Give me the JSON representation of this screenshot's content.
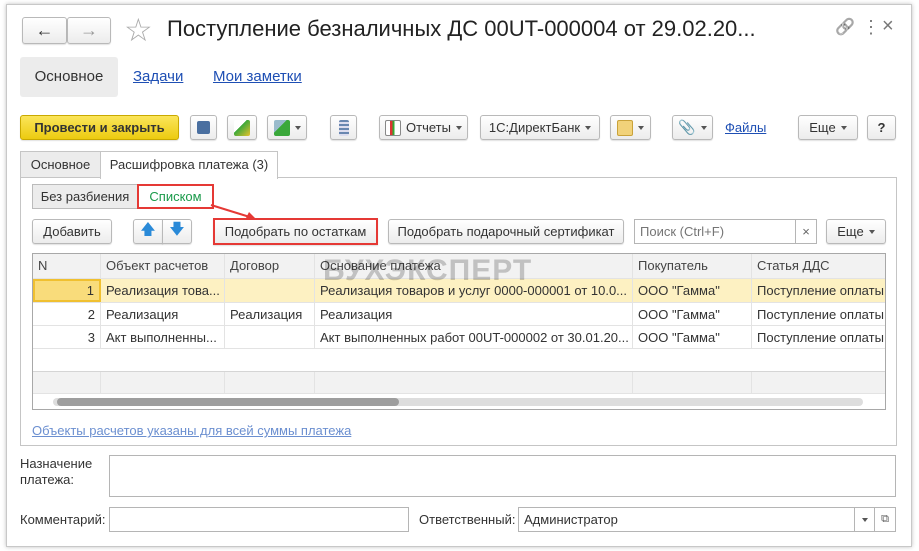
{
  "window": {
    "title": "Поступление безналичных ДС 00UT-000004 от 29.02.20...",
    "back_icon": "←",
    "forward_icon": "→",
    "star_icon": "☆",
    "link_icon": "🔗",
    "more_icon": "⋮",
    "close_icon": "×"
  },
  "nav": {
    "tabs": [
      "Основное",
      "Задачи",
      "Мои заметки"
    ]
  },
  "toolbar": {
    "post_close": "Провести и закрыть",
    "reports": "Отчеты",
    "directbank": "1С:ДиректБанк",
    "files": "Файлы",
    "more": "Еще",
    "help": "?"
  },
  "form_tabs": [
    "Основное",
    "Расшифровка платежа (3)"
  ],
  "split": {
    "options": [
      "Без разбиения",
      "Списком"
    ]
  },
  "table_toolbar": {
    "add": "Добавить",
    "pick_balance": "Подобрать по остаткам",
    "pick_cert": "Подобрать подарочный сертификат",
    "search_placeholder": "Поиск (Ctrl+F)",
    "clear": "×",
    "more": "Еще"
  },
  "table": {
    "columns": [
      "N",
      "Объект расчетов",
      "Договор",
      "Основание платежа",
      "Покупатель",
      "Статья ДДС"
    ],
    "rows": [
      [
        "1",
        "Реализация това...",
        "",
        "Реализация товаров и услуг 0000-000001 от 10.0...",
        "ООО \"Гамма\"",
        "Поступление оплаты"
      ],
      [
        "2",
        "Реализация",
        "Реализация",
        "Реализация",
        "ООО \"Гамма\"",
        "Поступление оплаты"
      ],
      [
        "3",
        "Акт выполненны...",
        "",
        "Акт выполненных работ 00UT-000002 от 30.01.20...",
        "ООО \"Гамма\"",
        "Поступление оплаты"
      ]
    ],
    "watermark": "БУХЭКСПЕРТ"
  },
  "note_link": "Объекты расчетов указаны для всей суммы платежа",
  "purpose": {
    "label": "Назначение платежа:",
    "value": ""
  },
  "comment": {
    "label": "Комментарий:",
    "value": ""
  },
  "responsible": {
    "label": "Ответственный:",
    "value": "Администратор"
  },
  "colors": {
    "accent_yellow": "#f5d622",
    "highlight": "#e53935",
    "selected_row": "#fdf1c2"
  }
}
